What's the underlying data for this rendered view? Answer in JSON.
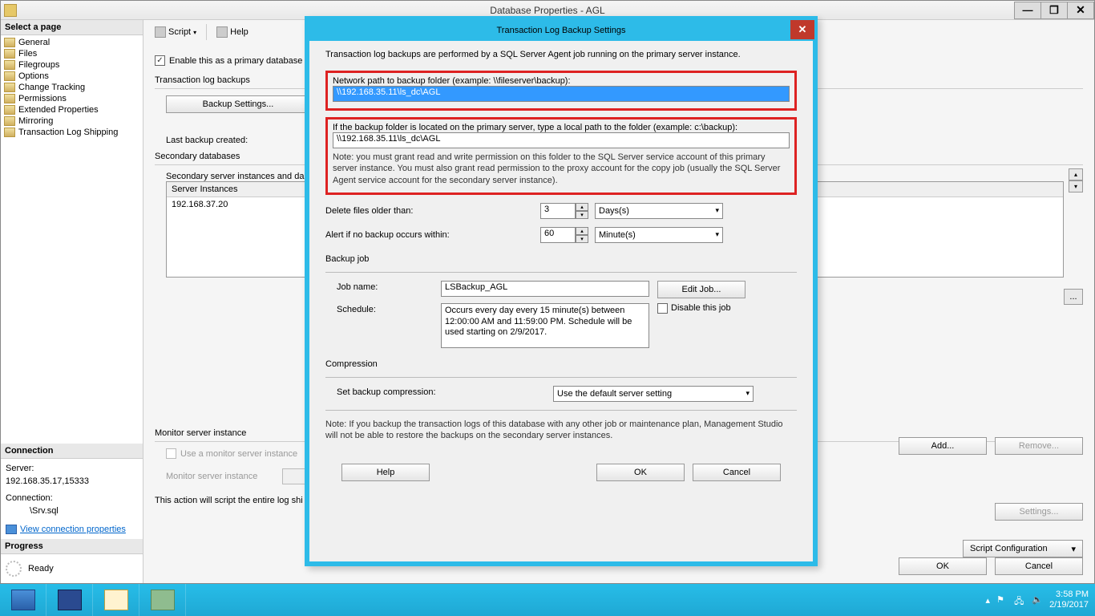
{
  "window": {
    "title": "Database Properties - AGL",
    "minimize": "—",
    "restore": "❐",
    "close": "✕"
  },
  "sidebar": {
    "header": "Select a page",
    "pages": [
      "General",
      "Files",
      "Filegroups",
      "Options",
      "Change Tracking",
      "Permissions",
      "Extended Properties",
      "Mirroring",
      "Transaction Log Shipping"
    ]
  },
  "connection": {
    "header": "Connection",
    "server_label": "Server:",
    "server_value": "192.168.35.17,15333",
    "conn_label": "Connection:",
    "conn_value": "\\Srv.sql",
    "view_props": "View connection properties"
  },
  "progress": {
    "header": "Progress",
    "status": "Ready"
  },
  "toolbar": {
    "script": "Script",
    "help": "Help"
  },
  "main": {
    "enable_checkbox": "Enable this as a primary database",
    "tlog_label": "Transaction log backups",
    "backup_settings_btn": "Backup Settings...",
    "last_backup_label": "Last backup created:",
    "secondary_label": "Secondary databases",
    "secondary_instances_label": "Secondary server instances and da",
    "table_header": "Server Instances",
    "table_row1": "192.168.37.20",
    "add_btn": "Add...",
    "remove_btn": "Remove...",
    "monitor_label": "Monitor server instance",
    "use_monitor_cb": "Use a monitor server instance",
    "monitor_field_label": "Monitor server instance",
    "settings_btn": "Settings...",
    "script_note": "This action will script the entire log shi",
    "script_config_btn": "Script Configuration",
    "ok": "OK",
    "cancel": "Cancel"
  },
  "modal": {
    "title": "Transaction Log Backup Settings",
    "intro": "Transaction log backups are performed by a SQL Server Agent job running on the primary server instance.",
    "network_path_label": "Network path to backup folder (example: \\\\fileserver\\backup):",
    "network_path_value": "\\\\192.168.35.11\\ls_dc\\AGL",
    "local_path_label": "If the backup folder is located on the primary server, type a local path to the folder (example: c:\\backup):",
    "local_path_value": "\\\\192.168.35.11\\ls_dc\\AGL",
    "note1": "Note: you must grant read and write permission on this folder to the SQL Server service account of this primary server instance. You must also grant read permission to the proxy account for the copy job (usually the SQL Server Agent service account for the secondary server instance).",
    "delete_label": "Delete files older than:",
    "delete_value": "3",
    "delete_unit": "Days(s)",
    "alert_label": "Alert if no backup occurs within:",
    "alert_value": "60",
    "alert_unit": "Minute(s)",
    "backup_job_label": "Backup job",
    "job_name_label": "Job name:",
    "job_name_value": "LSBackup_AGL",
    "edit_job_btn": "Edit Job...",
    "schedule_label": "Schedule:",
    "schedule_text": "Occurs every day every 15 minute(s) between 12:00:00 AM and 11:59:00 PM. Schedule will be used starting on 2/9/2017.",
    "disable_job": "Disable this job",
    "compression_label": "Compression",
    "compression_field": "Set backup compression:",
    "compression_value": "Use the default server setting",
    "note2": "Note: If you backup the transaction logs of this database with any other job or maintenance plan, Management Studio will not be able to restore the backups on the secondary server instances.",
    "help": "Help",
    "ok": "OK",
    "cancel": "Cancel"
  },
  "taskbar": {
    "time": "3:58 PM",
    "date": "2/19/2017"
  }
}
